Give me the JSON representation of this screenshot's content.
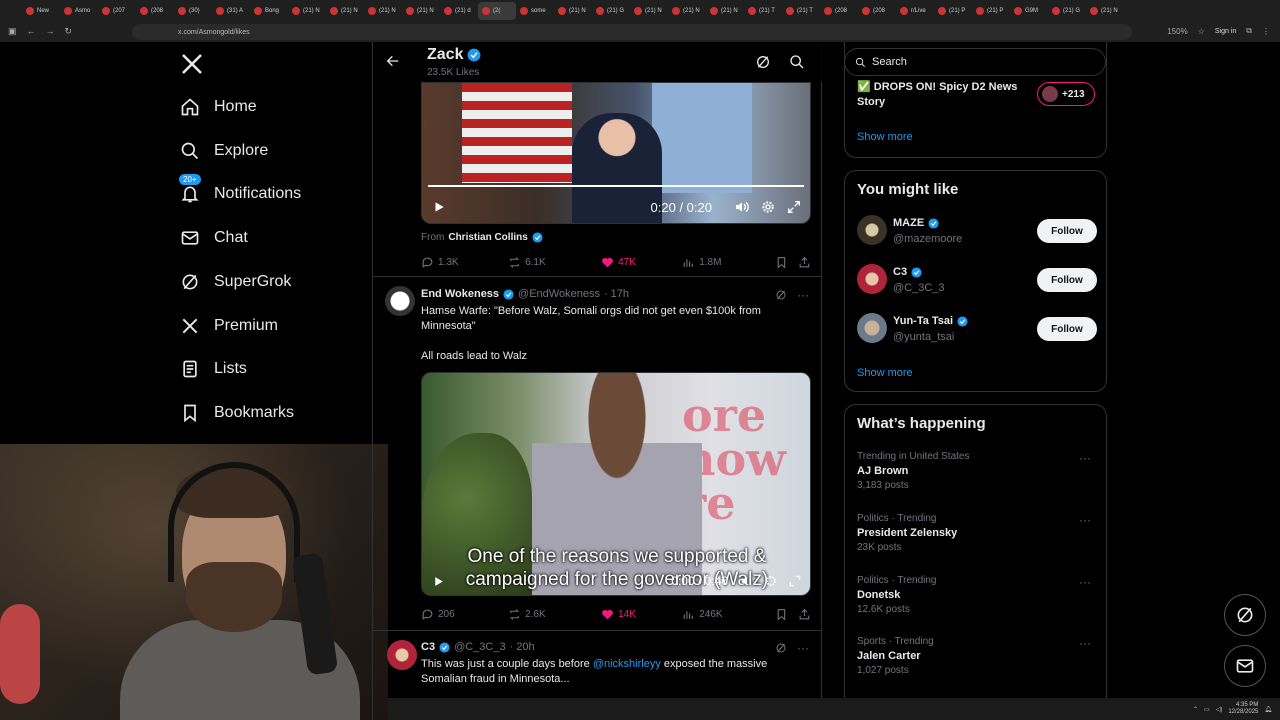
{
  "browser": {
    "tabs": [
      "New",
      "Asmo",
      "(207",
      "(208",
      "(30)",
      "(31) A",
      "Bong",
      "(21) N",
      "(21) N",
      "(21) N",
      "(21) N",
      "(21) d",
      "(2(",
      "some",
      "(21) N",
      "(21) G",
      "(21) N",
      "(21) N",
      "(21) N",
      "(21) T",
      "(21) T",
      "(208",
      "(208",
      "r/Live",
      "(21) P",
      "(21) P",
      "G9M",
      "(21) G",
      "(21) N"
    ],
    "url": "x.com/Asmongold/likes",
    "zoom": "150%",
    "signin": "Sign in"
  },
  "nav": {
    "items": [
      {
        "label": "Home",
        "icon": "home-icon"
      },
      {
        "label": "Explore",
        "icon": "search-icon"
      },
      {
        "label": "Notifications",
        "icon": "bell-icon",
        "badge": "20+"
      },
      {
        "label": "Chat",
        "icon": "mail-icon"
      },
      {
        "label": "SuperGrok",
        "icon": "grok-icon"
      },
      {
        "label": "Premium",
        "icon": "x-icon"
      },
      {
        "label": "Lists",
        "icon": "list-icon"
      },
      {
        "label": "Bookmarks",
        "icon": "bookmark-icon"
      }
    ]
  },
  "header": {
    "name": "Zack",
    "sub": "23.5K Likes"
  },
  "post1": {
    "video_time": "0:20 / 0:20",
    "progress": 1.0,
    "from_label": "From",
    "from_name": "Christian Collins",
    "replies": "1.3K",
    "reposts": "6.1K",
    "likes": "47K",
    "views": "1.8M"
  },
  "post2": {
    "name": "End Wokeness",
    "handle": "@EndWokeness",
    "time": "· 17h",
    "text1": "Hamse Warfe: \"Before Walz, Somali orgs did not get even $100k from Minnesota\"",
    "text2": "All roads lead to Walz",
    "bg_text": "ore\nnow\nre",
    "caption": "One of the reasons we supported & campaigned for the governor (Walz)",
    "video_time": "0:00 / 0:46",
    "replies": "206",
    "reposts": "2.6K",
    "likes": "14K",
    "views": "246K"
  },
  "post3": {
    "name": "C3",
    "handle": "@C_3C_3",
    "time": "· 20h",
    "text_pre": "This was just a couple days before ",
    "mention": "@nickshirleyy",
    "text_post": " exposed the massive Somalian fraud in Minnesota..."
  },
  "right": {
    "search_placeholder": "Search",
    "trend_top": "✅ DROPS ON! Spicy D2 News Story",
    "trend_top_count": "+213",
    "show_more": "Show more",
    "who_title": "You might like",
    "who": [
      {
        "name": "MAZE",
        "handle": "@mazemoore",
        "button": "Follow"
      },
      {
        "name": "C3",
        "handle": "@C_3C_3",
        "button": "Follow"
      },
      {
        "name": "Yun-Ta Tsai",
        "handle": "@yunta_tsai",
        "button": "Follow"
      }
    ],
    "happening_title": "What’s happening",
    "trends": [
      {
        "cat": "Trending in United States",
        "name": "AJ Brown",
        "count": "3,183 posts"
      },
      {
        "cat": "Politics · Trending",
        "name": "President Zelensky",
        "count": "23K posts"
      },
      {
        "cat": "Politics · Trending",
        "name": "Donetsk",
        "count": "12.6K posts"
      },
      {
        "cat": "Sports · Trending",
        "name": "Jalen Carter",
        "count": "1,027 posts"
      }
    ]
  },
  "taskbar": {
    "time": "4:35 PM",
    "date": "12/28/2025"
  },
  "colors": {
    "accent": "#1d9bf0",
    "like": "#f91880",
    "bg": "#000000",
    "border": "#2f3336",
    "muted": "#71767b"
  }
}
